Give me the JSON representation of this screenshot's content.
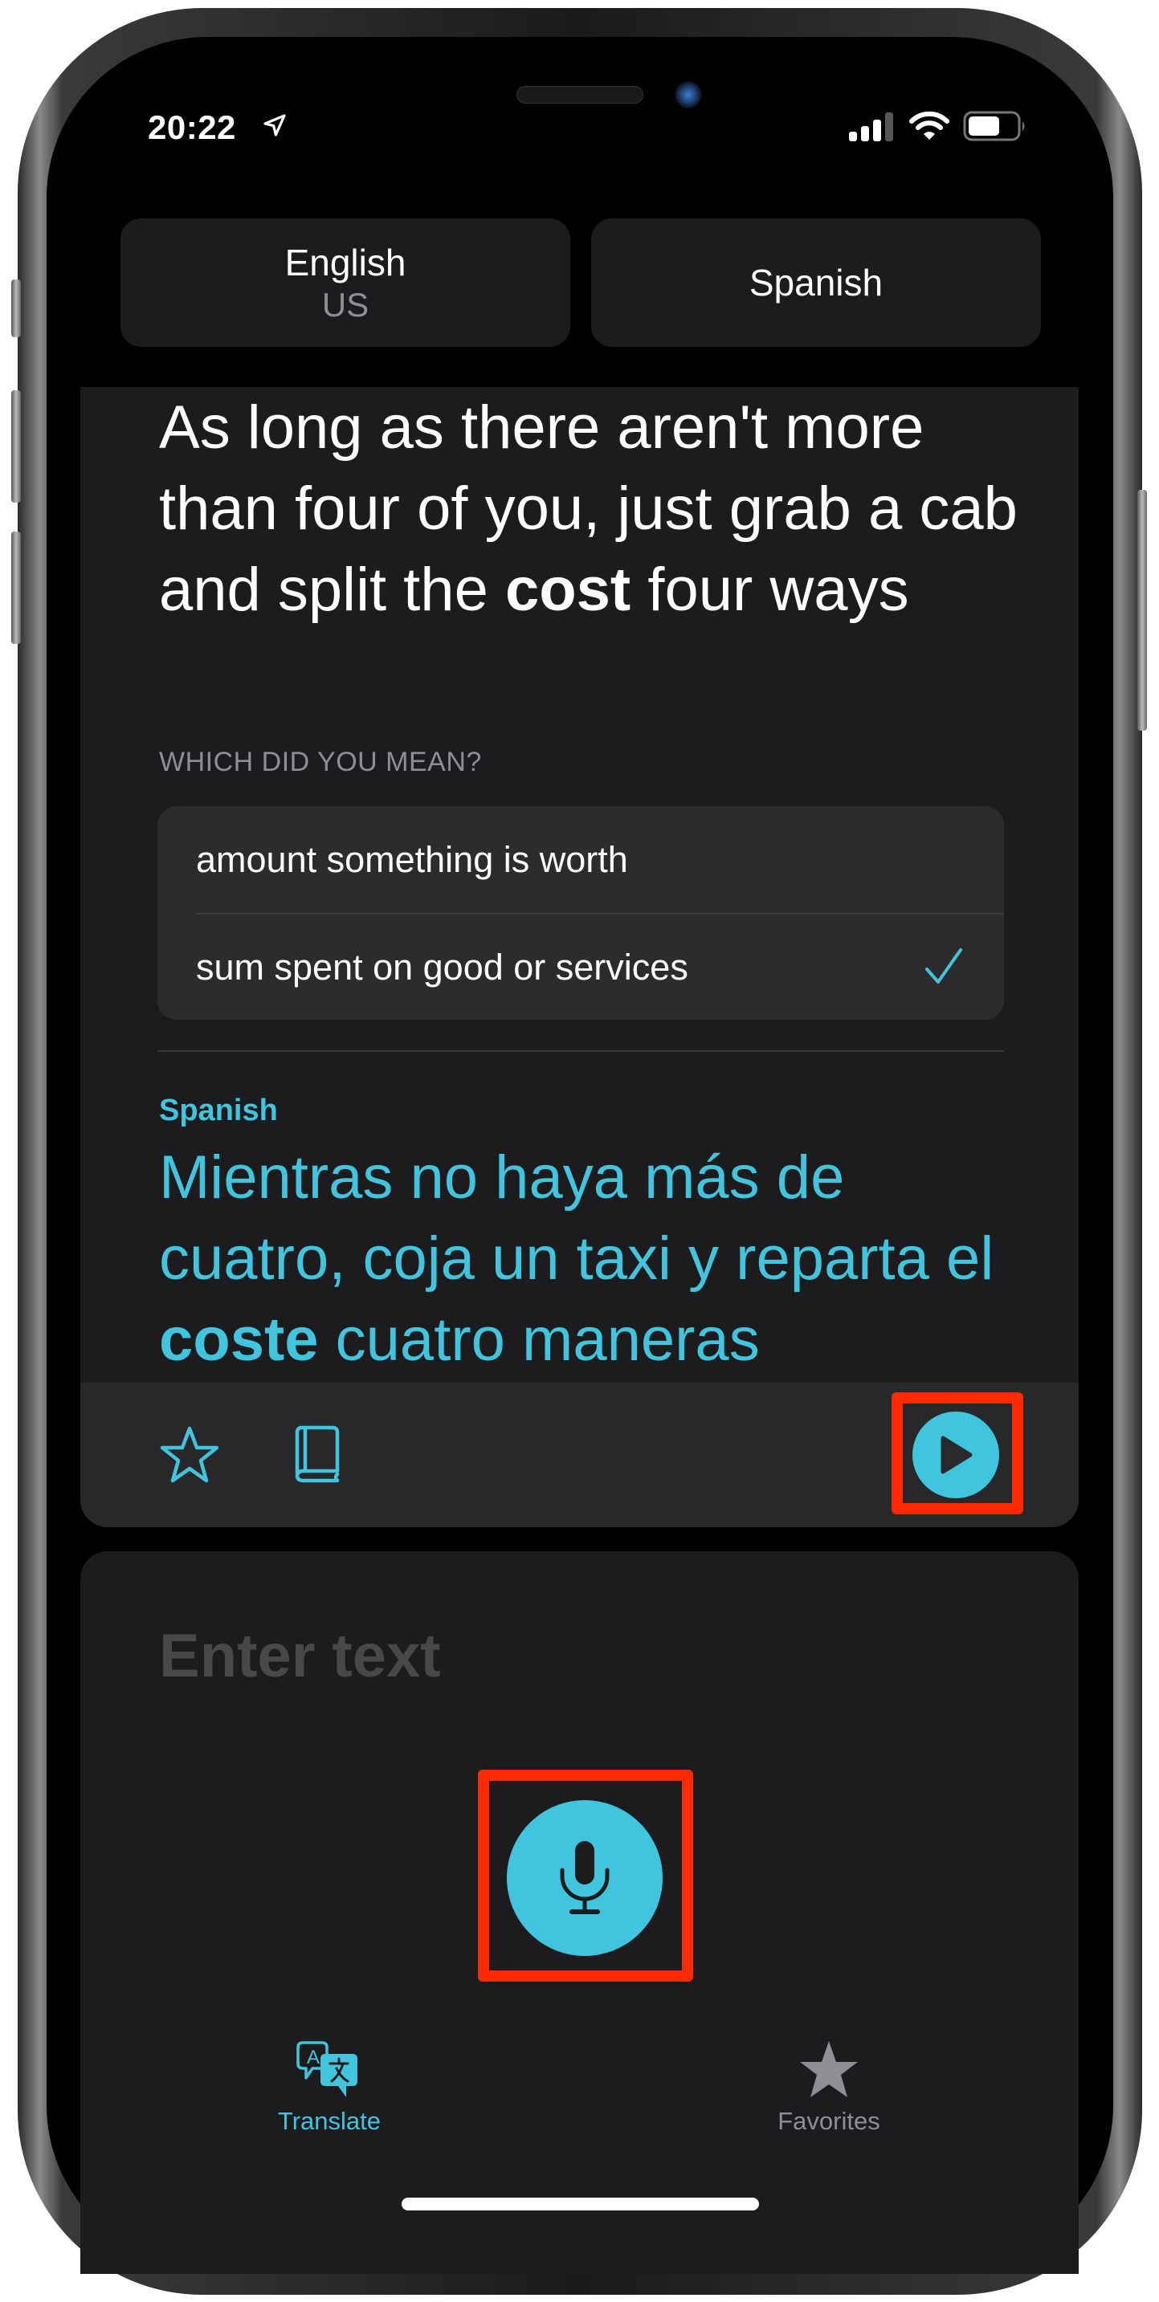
{
  "status_bar": {
    "time": "20:22",
    "location_icon": "location-arrow-icon",
    "signal_icon": "cellular-signal-icon",
    "wifi_icon": "wifi-icon",
    "battery_icon": "battery-icon"
  },
  "language_picker": {
    "source": {
      "name": "English",
      "region": "US"
    },
    "target": {
      "name": "Spanish"
    }
  },
  "translation": {
    "source_text_before": "As long as there aren't more than four of you, just grab a cab and split the ",
    "source_text_highlight": "cost",
    "source_text_after": " four ways",
    "disambiguation": {
      "label": "WHICH DID YOU MEAN?",
      "options": [
        {
          "label": "amount something is worth",
          "selected": false
        },
        {
          "label": "sum spent on good or services",
          "selected": true
        }
      ]
    },
    "target_language_label": "Spanish",
    "target_text_before": "Mientras no haya más de cuatro, coja un taxi y reparta el ",
    "target_text_highlight": "coste",
    "target_text_after": " cuatro maneras",
    "actions": {
      "favorite_icon": "star-outline-icon",
      "dictionary_icon": "book-icon",
      "play_icon": "play-icon"
    }
  },
  "input": {
    "value": "",
    "placeholder": "Enter text",
    "mic_icon": "microphone-icon"
  },
  "tabbar": {
    "tabs": [
      {
        "label": "Translate",
        "icon": "translate-bubbles-icon",
        "active": true
      },
      {
        "label": "Favorites",
        "icon": "star-filled-icon",
        "active": false
      }
    ]
  },
  "colors": {
    "accent": "#41c5df",
    "highlight_annotation": "#ff2a00",
    "card_bg": "#1c1c1e",
    "secondary_text": "#8e8e93"
  }
}
